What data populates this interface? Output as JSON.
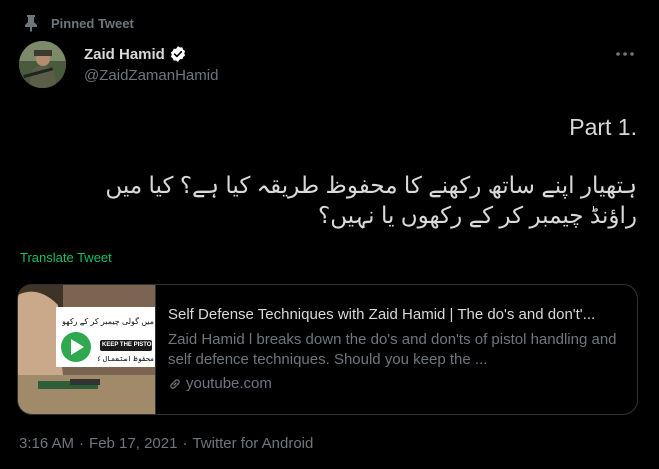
{
  "pinned": {
    "label": "Pinned Tweet",
    "icon": "pin-icon"
  },
  "author": {
    "name": "Zaid Hamid",
    "handle": "@ZaidZamanHamid",
    "verified": true,
    "verified_color": "#ffffff"
  },
  "tweet": {
    "part": ".Part 1",
    "urdu_line1": "ہتھیار اپنے ساتھ رکھنے کا محفوظ طریقہ کیا ہے؟ کیا میں",
    "urdu_line2": "راؤنڈ چیمبر کر کے رکھوں یا نہیں؟"
  },
  "translate": {
    "label": "Translate Tweet",
    "color": "#17bf63"
  },
  "card": {
    "title": "Self Defense Techniques with Zaid Hamid | The do's and don't'...",
    "description": "Zaid Hamid l breaks down the do's and don'ts of pistol handling and self defence techniques. Should you keep the ...",
    "domain": "youtube.com",
    "thumb_text_top": "میں گولی چیمبر کر کے رکھوں؟",
    "thumb_text_mid": "KEEP THE PISTOL",
    "thumb_text_bot": "محفوظ استعمال کیا ہے"
  },
  "meta": {
    "time": "3:16 AM",
    "date": "Feb 17, 2021",
    "source": "Twitter for Android",
    "separator": "·"
  }
}
